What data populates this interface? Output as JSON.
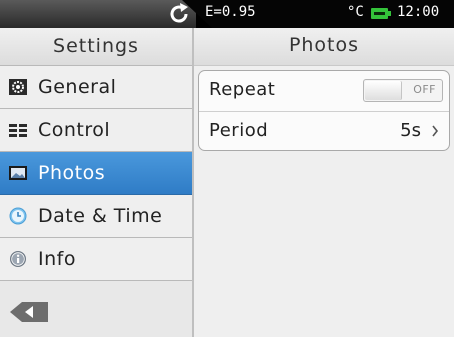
{
  "status": {
    "emissivity": "E=0.95",
    "unit": "°C",
    "time": "12:00",
    "icons": [
      "refresh-icon",
      "battery-icon"
    ]
  },
  "sidebar": {
    "title": "Settings",
    "items": [
      {
        "label": "General",
        "icon": "gear-icon",
        "active": false
      },
      {
        "label": "Control",
        "icon": "control-icon",
        "active": false
      },
      {
        "label": "Photos",
        "icon": "photo-icon",
        "active": true
      },
      {
        "label": "Date & Time",
        "icon": "clock-icon",
        "active": false
      },
      {
        "label": "Info",
        "icon": "info-icon",
        "active": false
      }
    ],
    "back_icon": "back-arrow-icon"
  },
  "panel": {
    "title": "Photos",
    "settings": [
      {
        "label": "Repeat",
        "toggle_text": "OFF",
        "toggle_on": false
      },
      {
        "label": "Period",
        "value": "5s"
      }
    ]
  },
  "colors": {
    "accent": "#3a8ad4",
    "statusbar": "#000000",
    "battery": "#34c33a"
  }
}
